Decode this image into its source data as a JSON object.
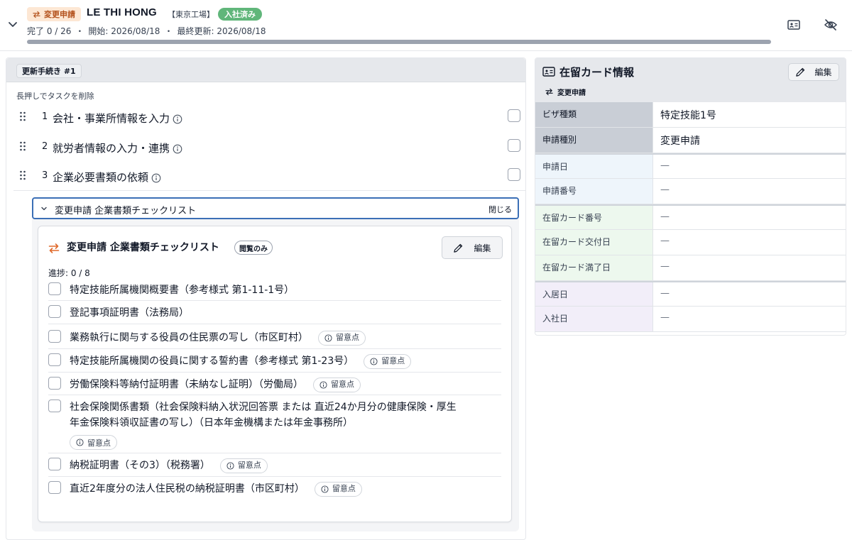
{
  "header": {
    "badge_change": "変更申請",
    "employee_name": "LE THI HONG",
    "factory": "【東京工場】",
    "status_badge": "入社済み",
    "progress_text": "完了 0 / 26",
    "start_text": "開始: 2026/08/18",
    "updated_text": "最終更新: 2026/08/18",
    "progress_fraction": 0,
    "separator": "・"
  },
  "left": {
    "section_tab": "更新手続き #1",
    "hint": "長押しでタスクを削除",
    "tasks": [
      {
        "num": "1",
        "label": "会社・事業所情報を入力"
      },
      {
        "num": "2",
        "label": "就労者情報の入力・連携"
      },
      {
        "num": "3",
        "label": "企業必要書類の依頼"
      }
    ],
    "accordion": {
      "title": "変更申請 企業書類チェックリスト",
      "close": "閉じる"
    },
    "checklist": {
      "title": "変更申請 企業書類チェックリスト",
      "readonly_badge": "閲覧のみ",
      "edit_label": "編集",
      "progress": "進捗: 0 / 8",
      "note_label": "留意点",
      "items": [
        {
          "line1": "特定技能所属機関概要書（参考様式 第1-11-1号）",
          "line2": "",
          "note": false
        },
        {
          "line1": "登記事項証明書（法務局）",
          "line2": "",
          "note": false
        },
        {
          "line1": "業務執行に関与する役員の住民票の写し（市区町村）",
          "line2": "",
          "note": true
        },
        {
          "line1": "特定技能所属機関の役員に関する誓約書（参考様式 第1-23号）",
          "line2": "",
          "note": true
        },
        {
          "line1": "労働保険料等納付証明書（未納なし証明）（労働局）",
          "line2": "",
          "note": true
        },
        {
          "line1": "社会保険関係書類（社会保険料納入状況回答票 または 直近24か月分の健康保険・厚生",
          "line2": "年金保険料領収証書の写し）（日本年金機構または年金事務所）",
          "note": true
        },
        {
          "line1": "納税証明書（その3）（税務署）",
          "line2": "",
          "note": true
        },
        {
          "line1": "直近2年度分の法人住民税の納税証明書（市区町村）",
          "line2": "",
          "note": true
        }
      ]
    }
  },
  "right": {
    "title": "在留カード情報",
    "edit_label": "編集",
    "sub_label": "変更申請",
    "rows": [
      {
        "key": "ビザ種類",
        "value": "特定技能1号"
      },
      {
        "key": "申請種別",
        "value": "変更申請"
      },
      {
        "key": "申請日",
        "value": "—"
      },
      {
        "key": "申請番号",
        "value": "—"
      },
      {
        "key": "在留カード番号",
        "value": "—"
      },
      {
        "key": "在留カード交付日",
        "value": "—"
      },
      {
        "key": "在留カード満了日",
        "value": "—"
      },
      {
        "key": "入居日",
        "value": "—"
      },
      {
        "key": "入社日",
        "value": "—"
      }
    ]
  },
  "icons": {
    "header_chevron": "chevron-down-icon",
    "id_card": "id-card-icon",
    "hide": "eye-off-icon",
    "drag": "drag-handle-icon",
    "info": "info-icon",
    "swap": "swap-arrows-icon",
    "pencil": "pencil-icon"
  },
  "colors": {
    "accent_blue": "#3b6fb6",
    "change_badge_bg": "#fde7d4",
    "change_badge_text": "#b4531e",
    "joined_badge": "#60b67a",
    "swap_orange": "#e06a2b"
  }
}
